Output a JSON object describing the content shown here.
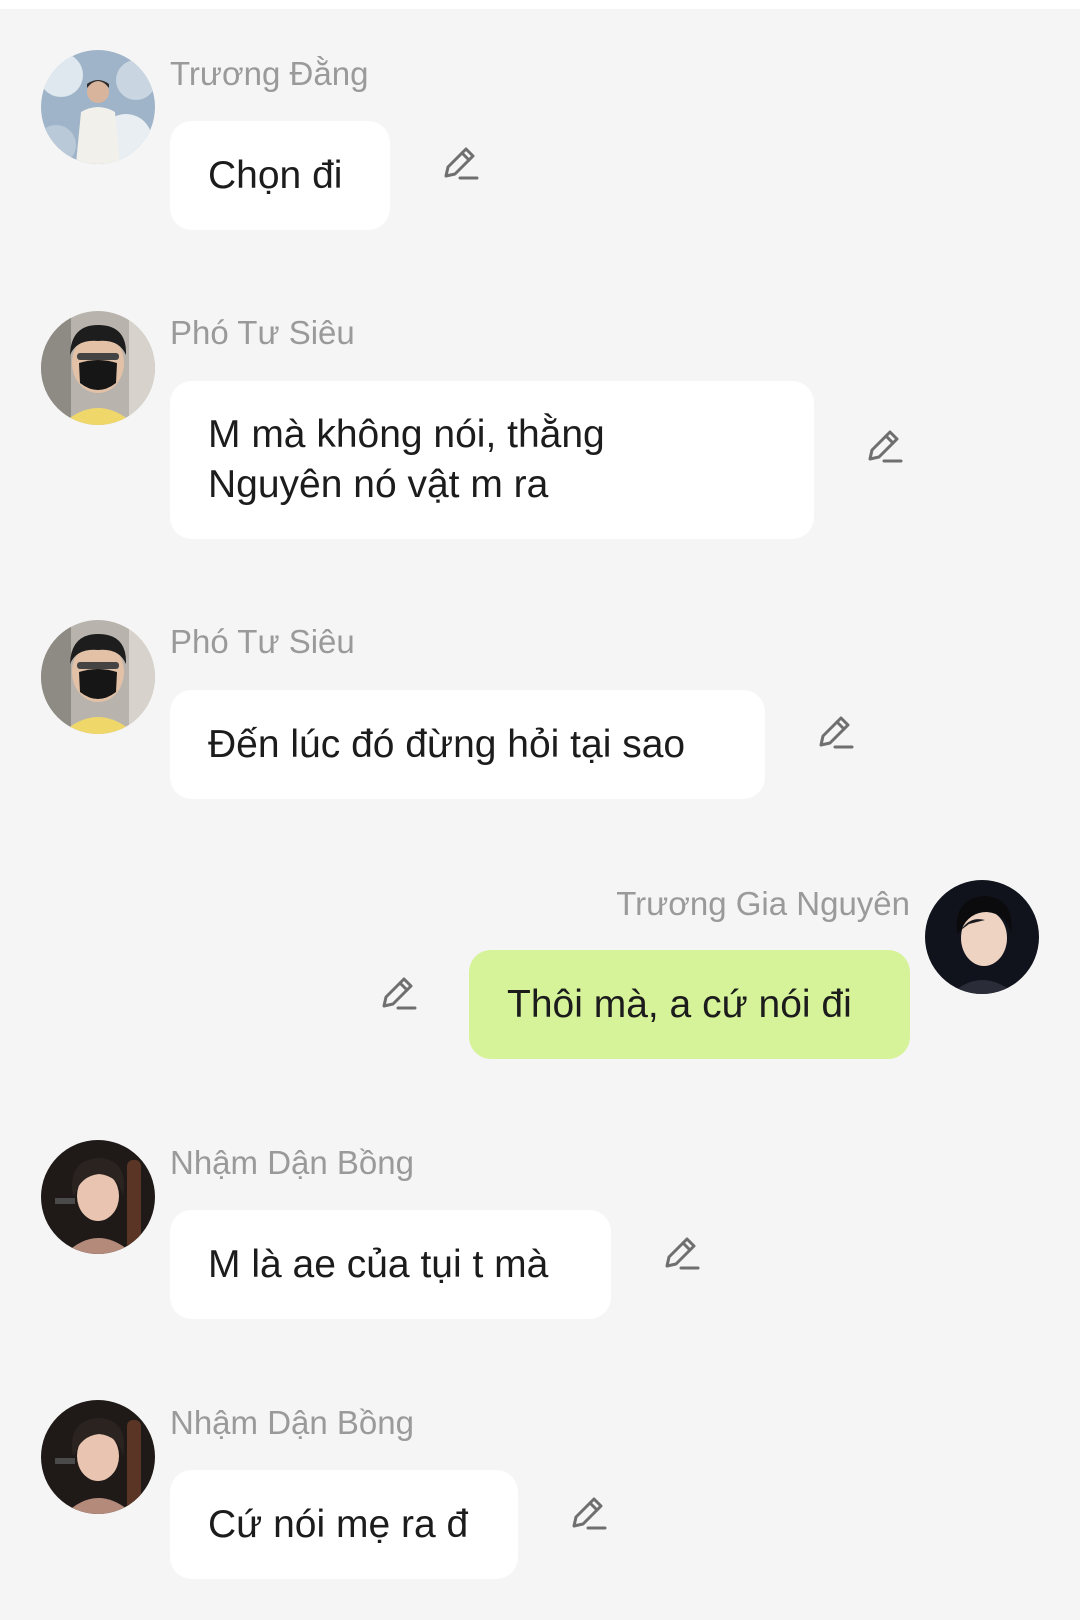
{
  "messages": [
    {
      "sender": "Trương Đằng",
      "text": "Chọn đi",
      "avatar": "avatar-truong-dang",
      "side": "left"
    },
    {
      "sender": "Phó Tư Siêu",
      "text": "M mà không nói, thằng\nNguyên nó vật m ra",
      "avatar": "avatar-pho-tu-sieu",
      "side": "left"
    },
    {
      "sender": "Phó Tư Siêu",
      "text": "Đến lúc đó đừng hỏi tại sao",
      "avatar": "avatar-pho-tu-sieu",
      "side": "left"
    },
    {
      "sender": "Trương Gia Nguyên",
      "text": "Thôi mà, a cứ nói đi",
      "avatar": "avatar-truong-gia-nguyen",
      "side": "right"
    },
    {
      "sender": "Nhậm Dận Bồng",
      "text": "M là ae của tụi t mà",
      "avatar": "avatar-nham-dan-bong",
      "side": "left"
    },
    {
      "sender": "Nhậm Dận Bồng",
      "text": "Cứ nói mẹ ra đ",
      "avatar": "avatar-nham-dan-bong",
      "side": "left"
    }
  ],
  "icons": {
    "edit": "pencil-edit-icon"
  },
  "colors": {
    "background": "#f5f5f5",
    "bubble_other": "#ffffff",
    "bubble_self": "#d6f39a",
    "sender_text": "#9a9a9a",
    "message_text": "#1c1c1c"
  }
}
